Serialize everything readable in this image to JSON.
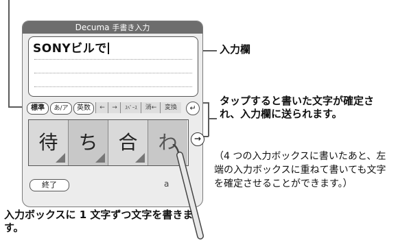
{
  "screen": {
    "title_brand": "Decuma",
    "title_rest": "手書き入力",
    "input_text": "SONYビルで",
    "toolbar": {
      "std_label": "標準",
      "kana_label": "あ/ア",
      "alnum_label": "英数",
      "left_key": "←",
      "right_key": "→",
      "space_key": "ｽﾍﾟｰｽ",
      "delete_key": "消←",
      "convert_key": "変換",
      "enter_icon": "return-icon"
    },
    "input_boxes": [
      "待",
      "ち",
      "合",
      "わ"
    ],
    "advance_icon": "arrow-right-icon",
    "end_label": "終了",
    "mode_indicator": "a"
  },
  "callouts": {
    "input_field": "入力欄",
    "confirm_title": "タップすると書いた文字が確定され、入力欄に送られます。",
    "confirm_note": "（4 つの入力ボックスに書いたあと、左端の入力ボックスに重ねて書いても文字を確定させることができます。）",
    "input_box_label": "入力ボックスに 1 文字ずつ文字を書きます。"
  }
}
